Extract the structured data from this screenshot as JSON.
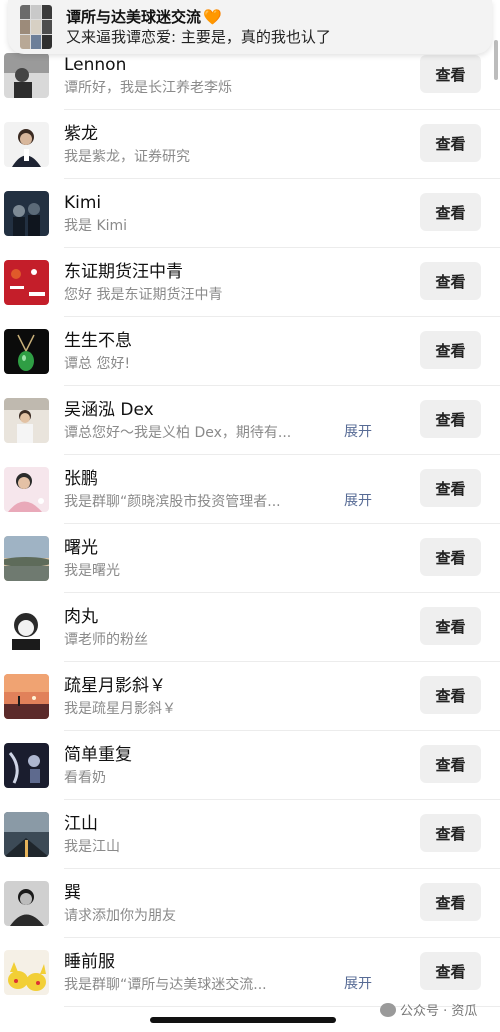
{
  "banner": {
    "title": "谭所与达美球迷交流",
    "heart": "🧡",
    "message": "又来逼我谭恋爱: 主要是，真的我也认了"
  },
  "action_label": "查看",
  "expand_label": "展开",
  "contacts": [
    {
      "name": "Lennon",
      "message": "谭所好，我是长江养老李烁",
      "expand": ""
    },
    {
      "name": "紫龙",
      "message": "我是紫龙，证券研究",
      "expand": ""
    },
    {
      "name": "Kimi",
      "message": "我是 Kimi",
      "expand": ""
    },
    {
      "name": "东证期货汪中青",
      "message": "您好 我是东证期货汪中青",
      "expand": ""
    },
    {
      "name": "生生不息",
      "message": "谭总 您好!",
      "expand": ""
    },
    {
      "name": "吴涵泓 Dex",
      "message": "谭总您好～我是义柏 Dex，期待有...",
      "expand": "展开"
    },
    {
      "name": "张鹏",
      "message": "我是群聊“颜晓滨股市投资管理者...",
      "expand": "展开"
    },
    {
      "name": "曙光",
      "message": "我是曙光",
      "expand": ""
    },
    {
      "name": "肉丸",
      "message": "谭老师的粉丝",
      "expand": ""
    },
    {
      "name": "疏星月影斜￥",
      "message": "我是疏星月影斜￥",
      "expand": ""
    },
    {
      "name": "简单重复",
      "message": "看看奶",
      "expand": ""
    },
    {
      "name": "江山",
      "message": "我是江山",
      "expand": ""
    },
    {
      "name": "巽",
      "message": "请求添加你为朋友",
      "expand": ""
    },
    {
      "name": "睡前服",
      "message": "我是群聊“谭所与达美球迷交流...",
      "expand": "展开"
    }
  ],
  "watermark": "公众号 · 资瓜",
  "colors": {
    "link": "#576b95",
    "button_bg": "#efefef",
    "secondary_text": "#8a8a8a"
  }
}
